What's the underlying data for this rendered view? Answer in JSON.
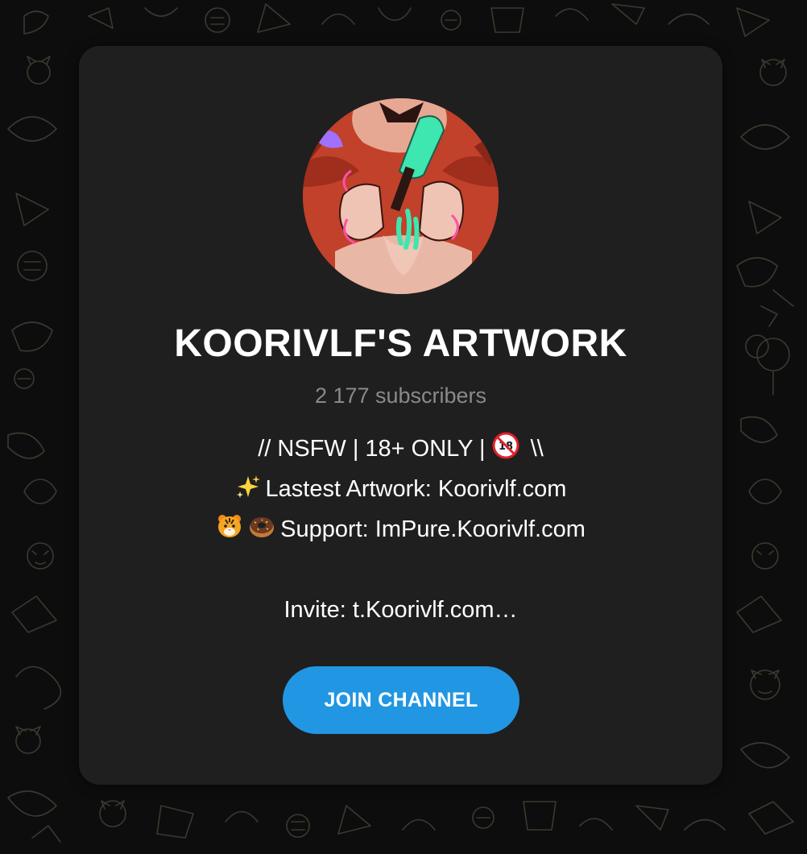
{
  "channel": {
    "title": "KOORIVLF'S ARTWORK",
    "subscribers": "2 177 subscribers",
    "avatar_icon": "channel-avatar-artwork"
  },
  "description": {
    "line1": "// NSFW | 18+ ONLY |  ",
    "line1_end": " \\\\",
    "line2": "Lastest Artwork: Koorivlf.com",
    "line3": "Support: ImPure.Koorivlf.com",
    "line4": "",
    "line5": "Invite: t.Koorivlf.com…"
  },
  "icons": {
    "no_under_18": "no-one-under-18-icon",
    "sparkles": "sparkles-icon",
    "tiger": "tiger-face-icon",
    "donut": "donut-icon"
  },
  "actions": {
    "join_label": "JOIN CHANNEL"
  },
  "colors": {
    "accent": "#2196e3",
    "card": "#1f1f1f",
    "background": "#0d0d0d",
    "muted": "#8a8a8a"
  }
}
